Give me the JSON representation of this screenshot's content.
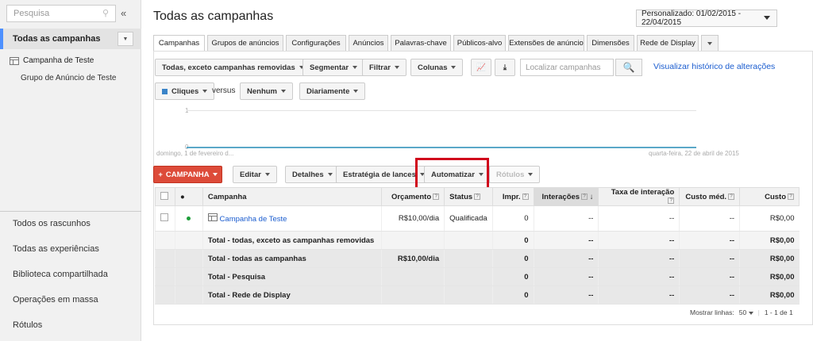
{
  "sidebar": {
    "search_placeholder": "Pesquisa",
    "collapse": "«",
    "all_campaigns": "Todas as campanhas",
    "campaign": "Campanha de Teste",
    "ad_group": "Grupo de Anúncio de Teste",
    "links": [
      "Todos os rascunhos",
      "Todas as experiências",
      "Biblioteca compartilhada",
      "Operações em massa",
      "Rótulos"
    ]
  },
  "header": {
    "title": "Todas as campanhas",
    "date_range": "Personalizado: 01/02/2015 - 22/04/2015"
  },
  "tabs": [
    "Campanhas",
    "Grupos de anúncios",
    "Configurações",
    "Anúncios",
    "Palavras-chave",
    "Públicos-alvo",
    "Extensões de anúncio",
    "Dimensões",
    "Rede de Display"
  ],
  "toolbar": {
    "filter_status": "Todas, exceto campanhas removidas",
    "segment": "Segmentar",
    "filter": "Filtrar",
    "columns": "Colunas",
    "find_placeholder": "Localizar campanhas",
    "history_link": "Visualizar histórico de alterações"
  },
  "chart_controls": {
    "metric": "Cliques",
    "versus": "versus",
    "compare": "Nenhum",
    "period": "Diariamente"
  },
  "chart": {
    "y_top": "1",
    "y_zero": "0",
    "start_label": "domingo, 1 de fevereiro d...",
    "end_label": "quarta-feira, 22 de abril de 2015"
  },
  "actions": {
    "campaign": "CAMPANHA",
    "edit": "Editar",
    "details": "Detalhes",
    "bid_strategy": "Estratégia de lances",
    "automate": "Automatizar",
    "labels": "Rótulos"
  },
  "table": {
    "headers": [
      "Campanha",
      "Orçamento",
      "Status",
      "Impr.",
      "Interações",
      "Taxa de interação",
      "Custo méd.",
      "Custo"
    ],
    "campaign_row": [
      "Campanha de Teste",
      "R$10,00/dia",
      "Qualificada",
      "0",
      "--",
      "--",
      "--",
      "R$0,00"
    ],
    "totals": [
      {
        "label": "Total - todas, exceto as campanhas removidas",
        "budget": "",
        "impr": "0",
        "inter": "--",
        "rate": "--",
        "avg": "--",
        "cost": "R$0,00"
      },
      {
        "label": "Total - todas as campanhas",
        "budget": "R$10,00/dia",
        "impr": "0",
        "inter": "--",
        "rate": "--",
        "avg": "--",
        "cost": "R$0,00"
      },
      {
        "label": "Total - Pesquisa",
        "budget": "",
        "impr": "0",
        "inter": "--",
        "rate": "--",
        "avg": "--",
        "cost": "R$0,00"
      },
      {
        "label": "Total - Rede de Display",
        "budget": "",
        "impr": "0",
        "inter": "--",
        "rate": "--",
        "avg": "--",
        "cost": "R$0,00"
      }
    ]
  },
  "footer": {
    "rows_label": "Mostrar linhas:",
    "rows_value": "50",
    "range": "1 - 1 de 1"
  }
}
